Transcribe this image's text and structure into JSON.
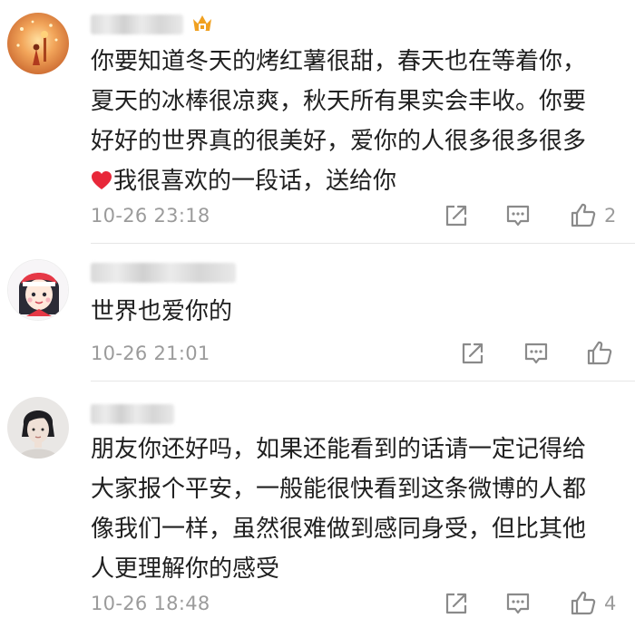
{
  "comments": [
    {
      "lines": [
        "你要知道冬天的烤红薯很甜，春天也在等着你，",
        "夏天的冰棒很凉爽，秋天所有果实会丰收。你要",
        "好好的世界真的很美好，爱你的人很多很多很多",
        "我很喜欢的一段话，送给你"
      ],
      "time": "10-26 23:18",
      "likes": "2"
    },
    {
      "lines": [
        "世界也爱你的"
      ],
      "time": "10-26 21:01",
      "likes": ""
    },
    {
      "lines": [
        "朋友你还好吗，如果还能看到的话请一定记得给",
        "大家报个平安，一般能很快看到这条微博的人都",
        "像我们一样，虽然很难做到感同身受，但比其他",
        "人更理解你的感受"
      ],
      "time": "10-26 18:48",
      "likes": "4"
    }
  ],
  "icons": {
    "share": "share-icon",
    "reply": "comment-icon",
    "like": "thumbs-up-icon",
    "heart": "heart-emoji-icon",
    "vip": "vip-crown-icon"
  },
  "colors": {
    "text": "#202020",
    "meta": "#9b9b9b",
    "heart": "#e8283a",
    "vip": "#f0a020"
  }
}
